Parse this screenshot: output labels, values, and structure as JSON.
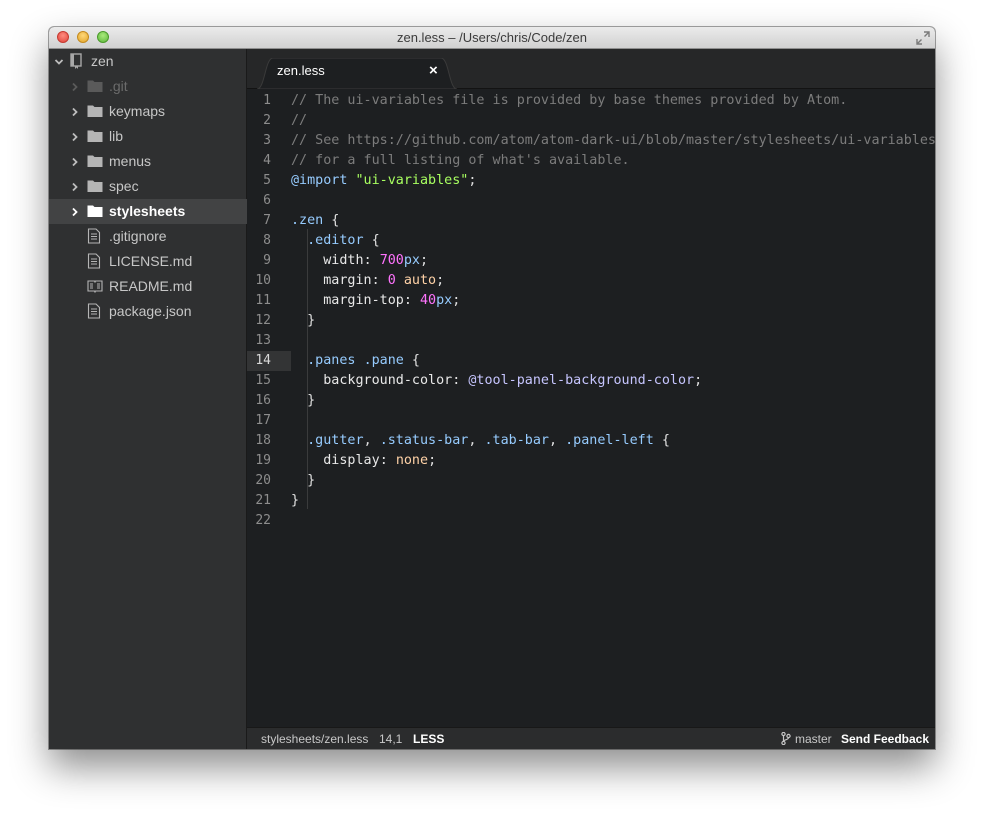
{
  "window": {
    "title": "zen.less – /Users/chris/Code/zen"
  },
  "sidebar": {
    "root": "zen",
    "items": [
      {
        "label": ".git",
        "kind": "folder"
      },
      {
        "label": "keymaps",
        "kind": "folder"
      },
      {
        "label": "lib",
        "kind": "folder"
      },
      {
        "label": "menus",
        "kind": "folder"
      },
      {
        "label": "spec",
        "kind": "folder"
      },
      {
        "label": "stylesheets",
        "kind": "folder",
        "selected": true
      },
      {
        "label": ".gitignore",
        "kind": "file"
      },
      {
        "label": "LICENSE.md",
        "kind": "file"
      },
      {
        "label": "README.md",
        "kind": "readme"
      },
      {
        "label": "package.json",
        "kind": "file"
      }
    ]
  },
  "tabs": [
    {
      "label": "zen.less",
      "close": "×"
    }
  ],
  "editor": {
    "active_line": 14,
    "lines": [
      [
        [
          "comment",
          "// The ui-variables file is provided by base themes provided by Atom."
        ]
      ],
      [
        [
          "comment",
          "//"
        ]
      ],
      [
        [
          "comment",
          "// See https://github.com/atom/atom-dark-ui/blob/master/stylesheets/ui-variables.less"
        ]
      ],
      [
        [
          "comment",
          "// for a full listing of what's available."
        ]
      ],
      [
        [
          "at",
          "@import"
        ],
        [
          "punc",
          " "
        ],
        [
          "str",
          "\"ui-variables\""
        ],
        [
          "punc",
          ";"
        ]
      ],
      [],
      [
        [
          "sel",
          ".zen"
        ],
        [
          "punc",
          " {"
        ]
      ],
      [
        [
          "punc",
          "  "
        ],
        [
          "sel",
          ".editor"
        ],
        [
          "punc",
          " {"
        ]
      ],
      [
        [
          "punc",
          "    "
        ],
        [
          "prop",
          "width"
        ],
        [
          "punc",
          ": "
        ],
        [
          "num",
          "700"
        ],
        [
          "sel",
          "px"
        ],
        [
          "punc",
          ";"
        ]
      ],
      [
        [
          "punc",
          "    "
        ],
        [
          "prop",
          "margin"
        ],
        [
          "punc",
          ": "
        ],
        [
          "num",
          "0"
        ],
        [
          "punc",
          " "
        ],
        [
          "val",
          "auto"
        ],
        [
          "punc",
          ";"
        ]
      ],
      [
        [
          "punc",
          "    "
        ],
        [
          "prop",
          "margin-top"
        ],
        [
          "punc",
          ": "
        ],
        [
          "num",
          "40"
        ],
        [
          "sel",
          "px"
        ],
        [
          "punc",
          ";"
        ]
      ],
      [
        [
          "punc",
          "  }"
        ]
      ],
      [],
      [
        [
          "punc",
          "  "
        ],
        [
          "sel",
          ".panes"
        ],
        [
          "punc",
          " "
        ],
        [
          "sel",
          ".pane"
        ],
        [
          "punc",
          " {"
        ]
      ],
      [
        [
          "punc",
          "    "
        ],
        [
          "prop",
          "background-color"
        ],
        [
          "punc",
          ": "
        ],
        [
          "var",
          "@tool-panel-background-color"
        ],
        [
          "punc",
          ";"
        ]
      ],
      [
        [
          "punc",
          "  }"
        ]
      ],
      [],
      [
        [
          "punc",
          "  "
        ],
        [
          "sel",
          ".gutter"
        ],
        [
          "punc",
          ", "
        ],
        [
          "sel",
          ".status-bar"
        ],
        [
          "punc",
          ", "
        ],
        [
          "sel",
          ".tab-bar"
        ],
        [
          "punc",
          ", "
        ],
        [
          "sel",
          ".panel-left"
        ],
        [
          "punc",
          " {"
        ]
      ],
      [
        [
          "punc",
          "    "
        ],
        [
          "prop",
          "display"
        ],
        [
          "punc",
          ": "
        ],
        [
          "val",
          "none"
        ],
        [
          "punc",
          ";"
        ]
      ],
      [
        [
          "punc",
          "  }"
        ]
      ],
      [
        [
          "punc",
          "}"
        ]
      ],
      []
    ]
  },
  "statusbar": {
    "path": "stylesheets/zen.less",
    "cursor": "14,1",
    "grammar": "LESS",
    "branch": "master",
    "feedback": "Send Feedback"
  }
}
